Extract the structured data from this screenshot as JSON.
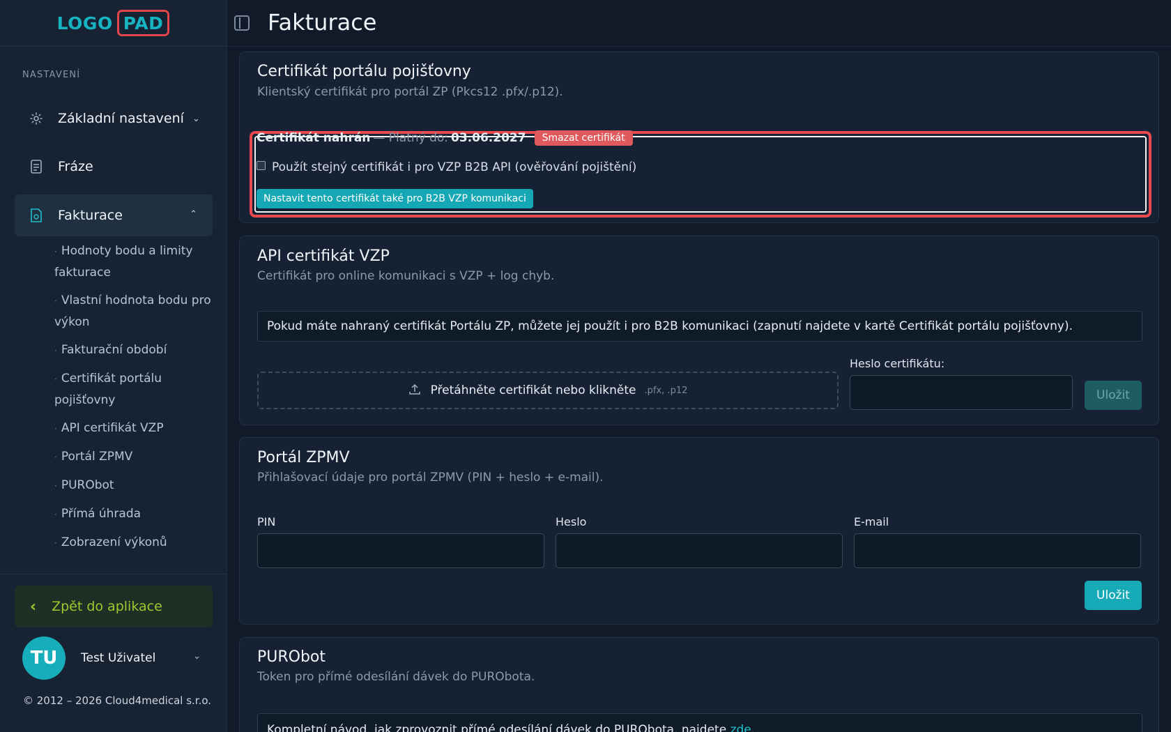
{
  "logo": {
    "part1": "LOGO",
    "part2": "PAD"
  },
  "sidebar": {
    "section_label": "NASTAVENÍ",
    "items": [
      {
        "label": "Základní nastavení",
        "icon": "gear-icon"
      },
      {
        "label": "Fráze",
        "icon": "document-icon"
      },
      {
        "label": "Fakturace",
        "icon": "invoice-icon"
      }
    ],
    "sub_items": [
      "Hodnoty bodu a limity fakturace",
      "Vlastní hodnota bodu pro výkon",
      "Fakturační období",
      "Certifikát portálu pojišťovny",
      "API certifikát VZP",
      "Portál ZPMV",
      "PURObot",
      "Přímá úhrada",
      "Zobrazení výkonů"
    ],
    "back_label": "Zpět do aplikace",
    "user": {
      "initials": "TU",
      "name": "Test Uživatel"
    },
    "copyright": "© 2012 – 2026 Cloud4medical s.r.o."
  },
  "header": {
    "title": "Fakturace"
  },
  "cert_portal": {
    "title": "Certifikát portálu pojišťovny",
    "subtitle": "Klientský certifikát pro portál ZP (Pkcs12 .pfx/.p12).",
    "status_label": "Certifikát nahrán",
    "valid_prefix": "— Platný do:",
    "valid_date": "03.06.2027",
    "delete_label": "Smazat certifikát",
    "checkbox_label": "Použít stejný certifikát i pro VZP B2B API (ověřování pojištění)",
    "set_b2b_label": "Nastavit tento certifikát také pro B2B VZP komunikaci"
  },
  "api_cert": {
    "title": "API certifikát VZP",
    "subtitle": "Certifikát pro online komunikaci s VZP + log chyb.",
    "info": "Pokud máte nahraný certifikát Portálu ZP, můžete jej použít i pro B2B komunikaci (zapnutí najdete v kartě Certifikát portálu pojišťovny).",
    "dropzone_label": "Přetáhněte certifikát nebo klikněte",
    "dropzone_ext": ".pfx, .p12",
    "password_label": "Heslo certifikátu:",
    "save_label": "Uložit"
  },
  "zpmv": {
    "title": "Portál ZPMV",
    "subtitle": "Přihlašovací údaje pro portál ZPMV (PIN + heslo + e-mail).",
    "pin_label": "PIN",
    "password_label": "Heslo",
    "email_label": "E-mail",
    "save_label": "Uložit"
  },
  "purobot": {
    "title": "PURObot",
    "subtitle": "Token pro přímé odesílání dávek do PURObota.",
    "guide_text": "Kompletní návod, jak zprovoznit přímé odesílání dávek do PURObota, najdete ",
    "guide_link": "zde",
    "guide_end": "."
  }
}
